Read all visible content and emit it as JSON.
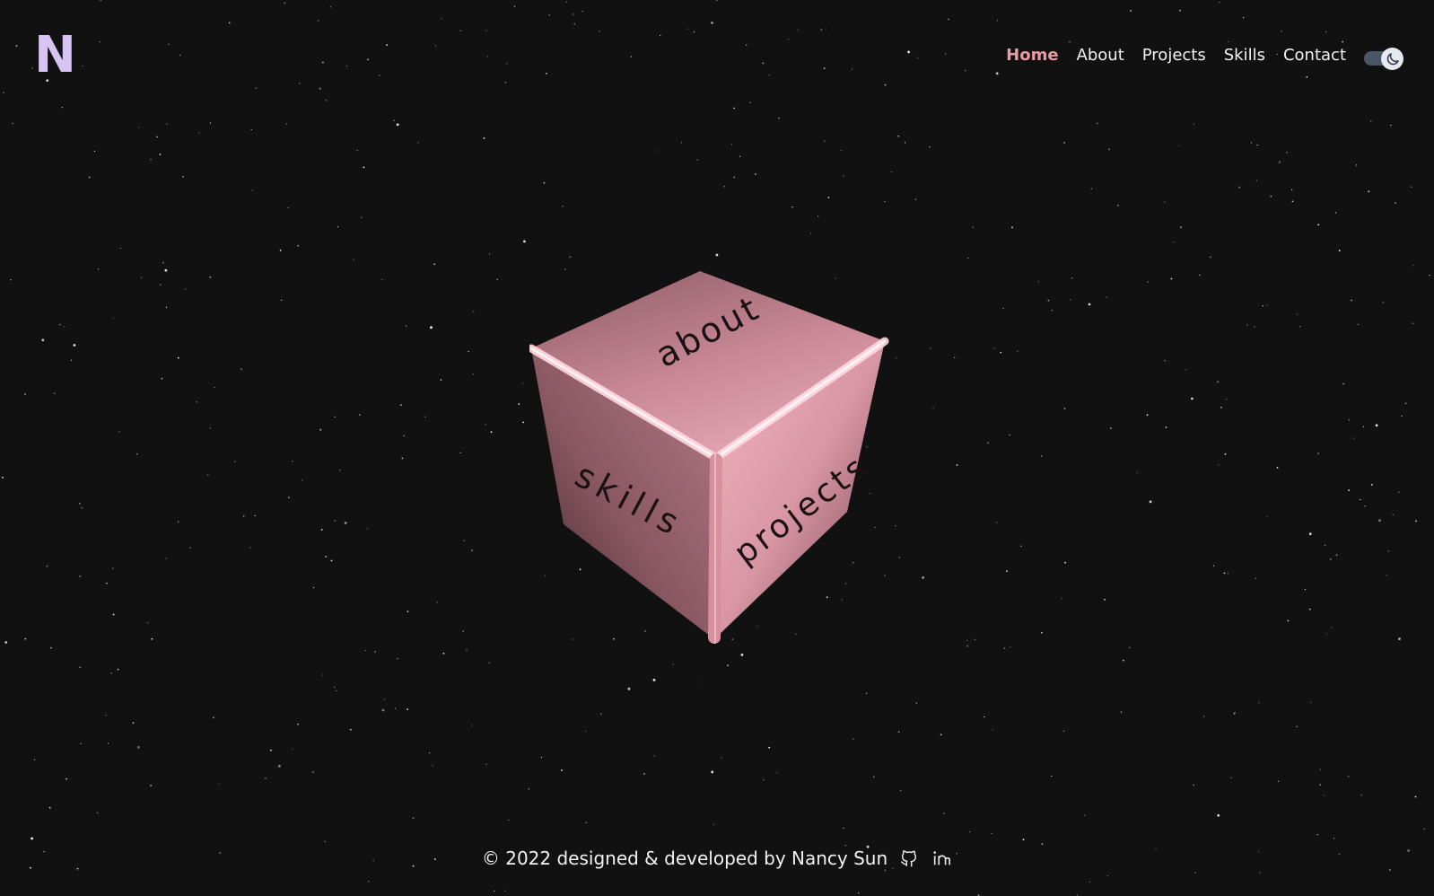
{
  "header": {
    "logo": "N",
    "nav": [
      {
        "label": "Home",
        "active": true
      },
      {
        "label": "About",
        "active": false
      },
      {
        "label": "Projects",
        "active": false
      },
      {
        "label": "Skills",
        "active": false
      },
      {
        "label": "Contact",
        "active": false
      }
    ],
    "theme_toggle_icon": "moon-icon"
  },
  "cube": {
    "faces": {
      "top": "about",
      "left": "skills",
      "right": "projects"
    },
    "color": "#e8a0ab"
  },
  "footer": {
    "text": "© 2022 designed & developed by Nancy Sun",
    "icons": [
      "github-icon",
      "linkedin-icon"
    ]
  },
  "colors": {
    "background": "#111111",
    "logo": "#d7c4f2",
    "nav_active": "#e89aa6",
    "nav_text": "#f2f2f2"
  }
}
